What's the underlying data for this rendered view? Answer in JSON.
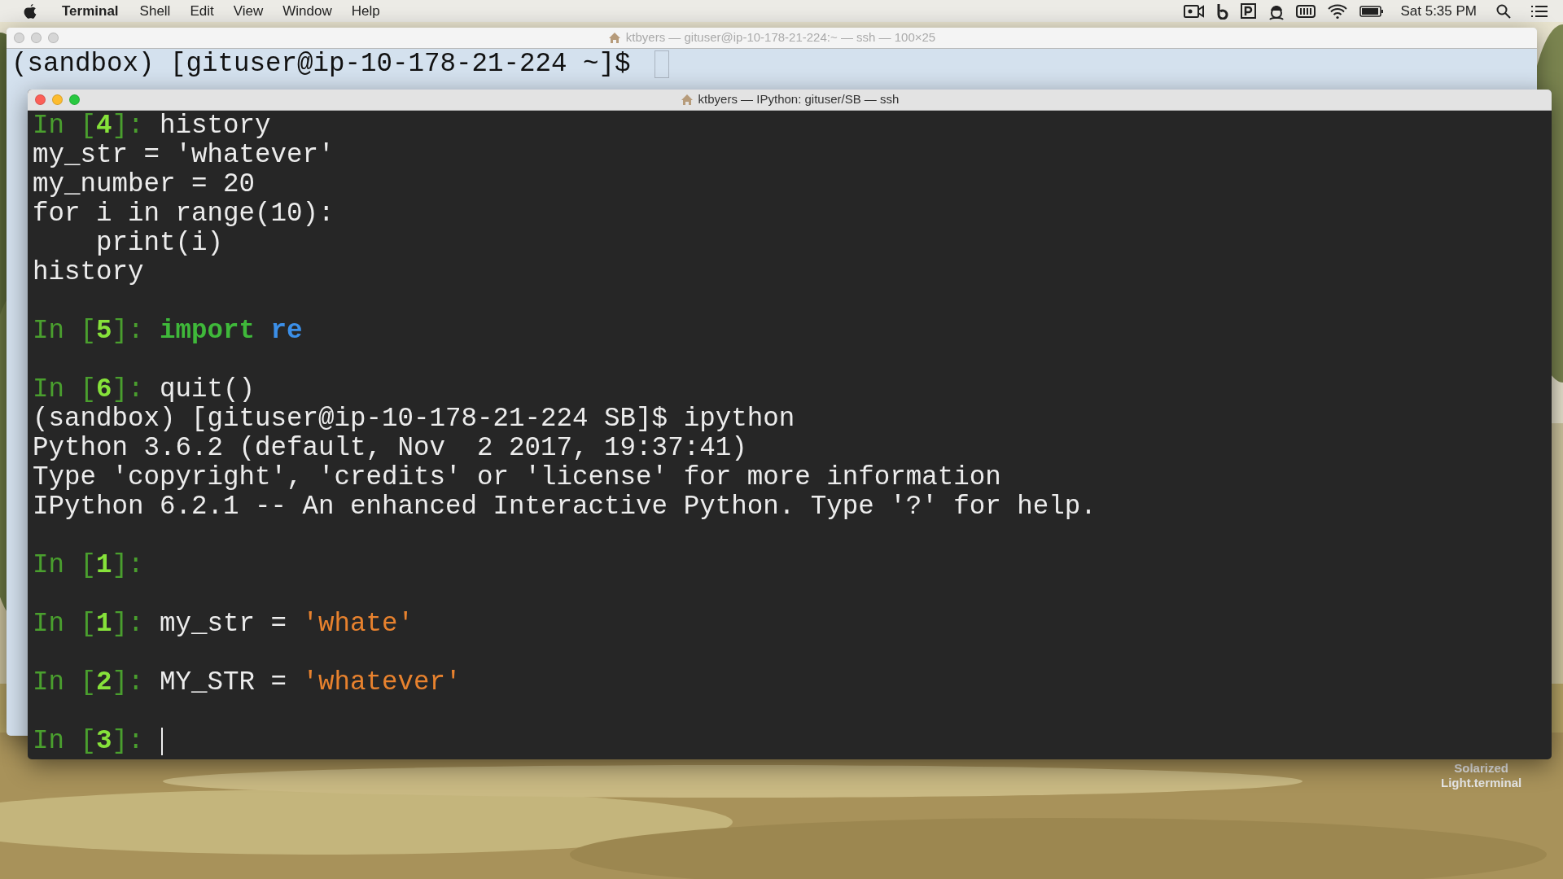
{
  "menu_bar": {
    "app": "Terminal",
    "menus": [
      "Shell",
      "Edit",
      "View",
      "Window",
      "Help"
    ],
    "clock": "Sat 5:35 PM"
  },
  "desktop_icon": {
    "label_lines": [
      "Solarized",
      "Light.terminal"
    ]
  },
  "windows": [
    {
      "title": "ktbyers — gituser@ip-10-178-21-224:~ — ssh — 100×25",
      "active": false,
      "kind": "light",
      "lines": [
        {
          "kind": "text",
          "segments": [
            {
              "kind": "plain",
              "text": "(sandbox) [gituser@ip-10-178-21-224 ~]$ "
            }
          ]
        }
      ]
    },
    {
      "title": "ktbyers — IPython: gituser/SB — ssh",
      "active": true,
      "kind": "dark",
      "lines": [
        {
          "kind": "text",
          "segments": [
            {
              "kind": "prompt",
              "text": "In ["
            },
            {
              "kind": "prompt_number",
              "text": "4"
            },
            {
              "kind": "prompt",
              "text": "]: "
            },
            {
              "kind": "plain",
              "text": "history"
            }
          ]
        },
        {
          "kind": "text",
          "segments": [
            {
              "kind": "plain",
              "text": "my_str = 'whatever'"
            }
          ]
        },
        {
          "kind": "text",
          "segments": [
            {
              "kind": "plain",
              "text": "my_number = 20"
            }
          ]
        },
        {
          "kind": "text",
          "segments": [
            {
              "kind": "plain",
              "text": "for i in range(10):"
            }
          ]
        },
        {
          "kind": "text",
          "segments": [
            {
              "kind": "plain",
              "text": "    print(i)"
            }
          ]
        },
        {
          "kind": "text",
          "segments": [
            {
              "kind": "plain",
              "text": "history"
            }
          ]
        },
        {
          "kind": "blank"
        },
        {
          "kind": "text",
          "segments": [
            {
              "kind": "prompt",
              "text": "In ["
            },
            {
              "kind": "prompt_number",
              "text": "5"
            },
            {
              "kind": "prompt",
              "text": "]: "
            },
            {
              "kind": "keyword",
              "text": "import "
            },
            {
              "kind": "module",
              "text": "re"
            }
          ]
        },
        {
          "kind": "blank"
        },
        {
          "kind": "text",
          "segments": [
            {
              "kind": "prompt",
              "text": "In ["
            },
            {
              "kind": "prompt_number",
              "text": "6"
            },
            {
              "kind": "prompt",
              "text": "]: "
            },
            {
              "kind": "plain",
              "text": "quit()"
            }
          ]
        },
        {
          "kind": "text",
          "segments": [
            {
              "kind": "plain",
              "text": "(sandbox) [gituser@ip-10-178-21-224 SB]$ ipython"
            }
          ]
        },
        {
          "kind": "text",
          "segments": [
            {
              "kind": "plain",
              "text": "Python 3.6.2 (default, Nov  2 2017, 19:37:41)"
            }
          ]
        },
        {
          "kind": "text",
          "segments": [
            {
              "kind": "plain",
              "text": "Type 'copyright', 'credits' or 'license' for more information"
            }
          ]
        },
        {
          "kind": "text",
          "segments": [
            {
              "kind": "plain",
              "text": "IPython 6.2.1 -- An enhanced Interactive Python. Type '?' for help."
            }
          ]
        },
        {
          "kind": "blank"
        },
        {
          "kind": "text",
          "segments": [
            {
              "kind": "prompt",
              "text": "In ["
            },
            {
              "kind": "prompt_number",
              "text": "1"
            },
            {
              "kind": "prompt",
              "text": "]: "
            }
          ]
        },
        {
          "kind": "blank"
        },
        {
          "kind": "text",
          "segments": [
            {
              "kind": "prompt",
              "text": "In ["
            },
            {
              "kind": "prompt_number",
              "text": "1"
            },
            {
              "kind": "prompt",
              "text": "]: "
            },
            {
              "kind": "plain",
              "text": "my_str = "
            },
            {
              "kind": "string",
              "text": "'whate'"
            }
          ]
        },
        {
          "kind": "blank"
        },
        {
          "kind": "text",
          "segments": [
            {
              "kind": "prompt",
              "text": "In ["
            },
            {
              "kind": "prompt_number",
              "text": "2"
            },
            {
              "kind": "prompt",
              "text": "]: "
            },
            {
              "kind": "plain",
              "text": "MY_STR = "
            },
            {
              "kind": "string",
              "text": "'whatever'"
            }
          ]
        },
        {
          "kind": "blank"
        },
        {
          "kind": "text",
          "segments": [
            {
              "kind": "prompt",
              "text": "In ["
            },
            {
              "kind": "prompt_number",
              "text": "3"
            },
            {
              "kind": "prompt",
              "text": "]: "
            }
          ]
        }
      ]
    }
  ]
}
